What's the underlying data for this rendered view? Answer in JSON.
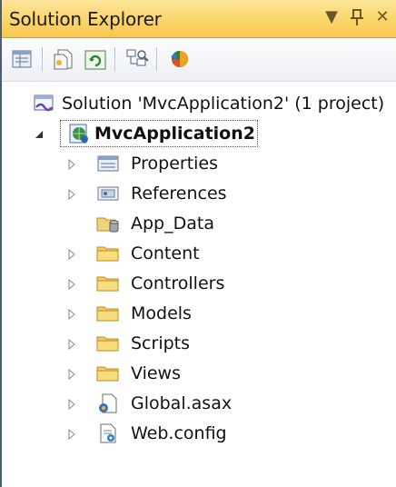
{
  "panel": {
    "title": "Solution Explorer",
    "controls": [
      "▼",
      "ꟸ",
      "✕"
    ]
  },
  "toolbar": {
    "buttons": [
      {
        "icon": "properties-window-icon"
      },
      {
        "icon": "show-all-files-icon"
      },
      {
        "icon": "refresh-icon"
      },
      {
        "icon": "view-class-diagram-icon"
      },
      {
        "icon": "copy-website-icon"
      }
    ]
  },
  "tree": {
    "solution": "Solution 'MvcApplication2' (1 project)",
    "project": "MvcApplication2",
    "items": [
      {
        "label": "Properties",
        "icon": "properties-icon",
        "expandable": true
      },
      {
        "label": "References",
        "icon": "references-icon",
        "expandable": true
      },
      {
        "label": "App_Data",
        "icon": "app-data-folder-icon",
        "expandable": false
      },
      {
        "label": "Content",
        "icon": "folder-icon",
        "expandable": true
      },
      {
        "label": "Controllers",
        "icon": "folder-icon",
        "expandable": true
      },
      {
        "label": "Models",
        "icon": "folder-icon",
        "expandable": true
      },
      {
        "label": "Scripts",
        "icon": "folder-icon",
        "expandable": true
      },
      {
        "label": "Views",
        "icon": "folder-icon",
        "expandable": true
      },
      {
        "label": "Global.asax",
        "icon": "global-asax-icon",
        "expandable": true
      },
      {
        "label": "Web.config",
        "icon": "config-file-icon",
        "expandable": true
      }
    ]
  }
}
